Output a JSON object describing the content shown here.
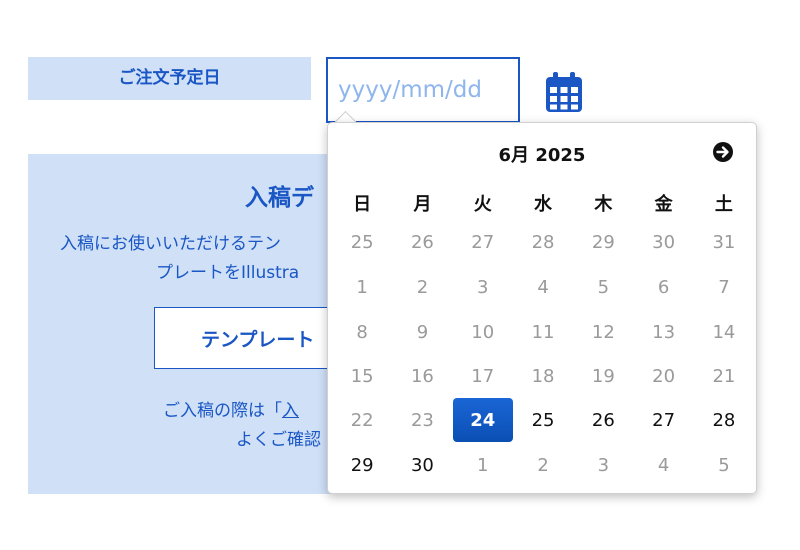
{
  "form": {
    "order_date_label": "ご注文予定日",
    "date_placeholder": "yyyy/mm/dd",
    "date_value": ""
  },
  "panel": {
    "title": "入稿デ",
    "desc_line1": "入稿にお使いいただけるテン",
    "desc_line2": "プレートをIllustra",
    "template_button": "テンプレート",
    "note_line1_prefix": "ご入稿の際は「",
    "note_line1_link": "入",
    "note_line2": "よくご確認"
  },
  "calendar": {
    "month_title": "6月 2025",
    "weekdays": [
      "日",
      "月",
      "火",
      "水",
      "木",
      "金",
      "土"
    ],
    "weeks": [
      [
        {
          "d": "25",
          "m": true
        },
        {
          "d": "26",
          "m": true
        },
        {
          "d": "27",
          "m": true
        },
        {
          "d": "28",
          "m": true
        },
        {
          "d": "29",
          "m": true
        },
        {
          "d": "30",
          "m": true
        },
        {
          "d": "31",
          "m": true
        }
      ],
      [
        {
          "d": "1",
          "m": true
        },
        {
          "d": "2",
          "m": true
        },
        {
          "d": "3",
          "m": true
        },
        {
          "d": "4",
          "m": true
        },
        {
          "d": "5",
          "m": true
        },
        {
          "d": "6",
          "m": true
        },
        {
          "d": "7",
          "m": true
        }
      ],
      [
        {
          "d": "8",
          "m": true
        },
        {
          "d": "9",
          "m": true
        },
        {
          "d": "10",
          "m": true
        },
        {
          "d": "11",
          "m": true
        },
        {
          "d": "12",
          "m": true
        },
        {
          "d": "13",
          "m": true
        },
        {
          "d": "14",
          "m": true
        }
      ],
      [
        {
          "d": "15",
          "m": true
        },
        {
          "d": "16",
          "m": true
        },
        {
          "d": "17",
          "m": true
        },
        {
          "d": "18",
          "m": true
        },
        {
          "d": "19",
          "m": true
        },
        {
          "d": "20",
          "m": true
        },
        {
          "d": "21",
          "m": true
        }
      ],
      [
        {
          "d": "22",
          "m": true
        },
        {
          "d": "23",
          "m": true
        },
        {
          "d": "24",
          "s": true
        },
        {
          "d": "25"
        },
        {
          "d": "26"
        },
        {
          "d": "27"
        },
        {
          "d": "28"
        }
      ],
      [
        {
          "d": "29"
        },
        {
          "d": "30"
        },
        {
          "d": "1",
          "m": true
        },
        {
          "d": "2",
          "m": true
        },
        {
          "d": "3",
          "m": true
        },
        {
          "d": "4",
          "m": true
        },
        {
          "d": "5",
          "m": true
        }
      ]
    ]
  },
  "colors": {
    "accent": "#1a56c4",
    "panel_bg": "#cfe0f7",
    "selected_bg": "#0b57c9",
    "muted_text": "#9a9a9a"
  },
  "icons": {
    "calendar_button": "calendar-icon",
    "next_month": "arrow-right-circle-icon"
  }
}
